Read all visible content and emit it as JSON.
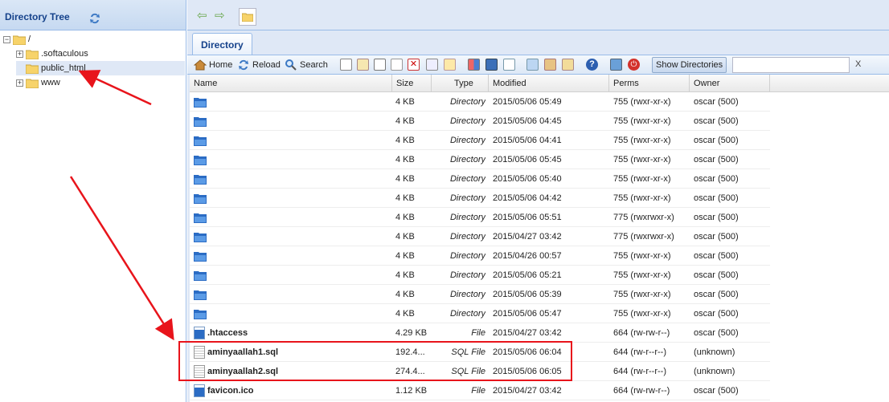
{
  "left_panel": {
    "title": "Directory Tree",
    "tree": [
      {
        "label": "/",
        "indent": 0,
        "expander": "−",
        "open": true,
        "selected": false
      },
      {
        "label": ".softaculous",
        "indent": 1,
        "expander": "+",
        "open": false,
        "selected": false
      },
      {
        "label": "public_html",
        "indent": 1,
        "expander": "",
        "open": false,
        "selected": true
      },
      {
        "label": "www",
        "indent": 1,
        "expander": "+",
        "open": false,
        "selected": false
      }
    ]
  },
  "tab": {
    "label": "Directory"
  },
  "toolbar": {
    "home_label": "Home",
    "reload_label": "Reload",
    "search_label": "Search",
    "show_dirs_label": "Show Directories",
    "filter_value": "",
    "filter_clear": "X"
  },
  "columns": [
    "Name",
    "Size",
    "Type",
    "Modified",
    "Perms",
    "Owner"
  ],
  "rows": [
    {
      "icon": "folder",
      "name": "",
      "size": "4 KB",
      "type": "Directory",
      "modified": "2015/05/06 05:49",
      "perms": "755 (rwxr-xr-x)",
      "owner": "oscar (500)"
    },
    {
      "icon": "folder",
      "name": "",
      "size": "4 KB",
      "type": "Directory",
      "modified": "2015/05/06 04:45",
      "perms": "755 (rwxr-xr-x)",
      "owner": "oscar (500)"
    },
    {
      "icon": "folder",
      "name": "",
      "size": "4 KB",
      "type": "Directory",
      "modified": "2015/05/06 04:41",
      "perms": "755 (rwxr-xr-x)",
      "owner": "oscar (500)"
    },
    {
      "icon": "folder",
      "name": "",
      "size": "4 KB",
      "type": "Directory",
      "modified": "2015/05/06 05:45",
      "perms": "755 (rwxr-xr-x)",
      "owner": "oscar (500)"
    },
    {
      "icon": "folder",
      "name": "",
      "size": "4 KB",
      "type": "Directory",
      "modified": "2015/05/06 05:40",
      "perms": "755 (rwxr-xr-x)",
      "owner": "oscar (500)"
    },
    {
      "icon": "folder",
      "name": "",
      "size": "4 KB",
      "type": "Directory",
      "modified": "2015/05/06 04:42",
      "perms": "755 (rwxr-xr-x)",
      "owner": "oscar (500)"
    },
    {
      "icon": "folder",
      "name": "",
      "size": "4 KB",
      "type": "Directory",
      "modified": "2015/05/06 05:51",
      "perms": "775 (rwxrwxr-x)",
      "owner": "oscar (500)"
    },
    {
      "icon": "folder",
      "name": "",
      "size": "4 KB",
      "type": "Directory",
      "modified": "2015/04/27 03:42",
      "perms": "775 (rwxrwxr-x)",
      "owner": "oscar (500)"
    },
    {
      "icon": "folder",
      "name": "",
      "size": "4 KB",
      "type": "Directory",
      "modified": "2015/04/26 00:57",
      "perms": "755 (rwxr-xr-x)",
      "owner": "oscar (500)"
    },
    {
      "icon": "folder",
      "name": "",
      "size": "4 KB",
      "type": "Directory",
      "modified": "2015/05/06 05:21",
      "perms": "755 (rwxr-xr-x)",
      "owner": "oscar (500)"
    },
    {
      "icon": "folder",
      "name": "",
      "size": "4 KB",
      "type": "Directory",
      "modified": "2015/05/06 05:39",
      "perms": "755 (rwxr-xr-x)",
      "owner": "oscar (500)"
    },
    {
      "icon": "folder",
      "name": "",
      "size": "4 KB",
      "type": "Directory",
      "modified": "2015/05/06 05:47",
      "perms": "755 (rwxr-xr-x)",
      "owner": "oscar (500)"
    },
    {
      "icon": "file",
      "name": ".htaccess",
      "size": "4.29 KB",
      "type": "File",
      "modified": "2015/04/27 03:42",
      "perms": "664 (rw-rw-r--)",
      "owner": "oscar (500)"
    },
    {
      "icon": "sql",
      "name": "aminyaallah1.sql",
      "size": "192.4...",
      "type": "SQL File",
      "modified": "2015/05/06 06:04",
      "perms": "644 (rw-r--r--)",
      "owner": "(unknown)"
    },
    {
      "icon": "sql",
      "name": "aminyaallah2.sql",
      "size": "274.4...",
      "type": "SQL File",
      "modified": "2015/05/06 06:05",
      "perms": "644 (rw-r--r--)",
      "owner": "(unknown)"
    },
    {
      "icon": "file",
      "name": "favicon.ico",
      "size": "1.12 KB",
      "type": "File",
      "modified": "2015/04/27 03:42",
      "perms": "664 (rw-rw-r--)",
      "owner": "oscar (500)"
    }
  ],
  "colors": {
    "accent": "#15428b",
    "highlight": "#e8141b",
    "folder": "#2b6cc4"
  }
}
